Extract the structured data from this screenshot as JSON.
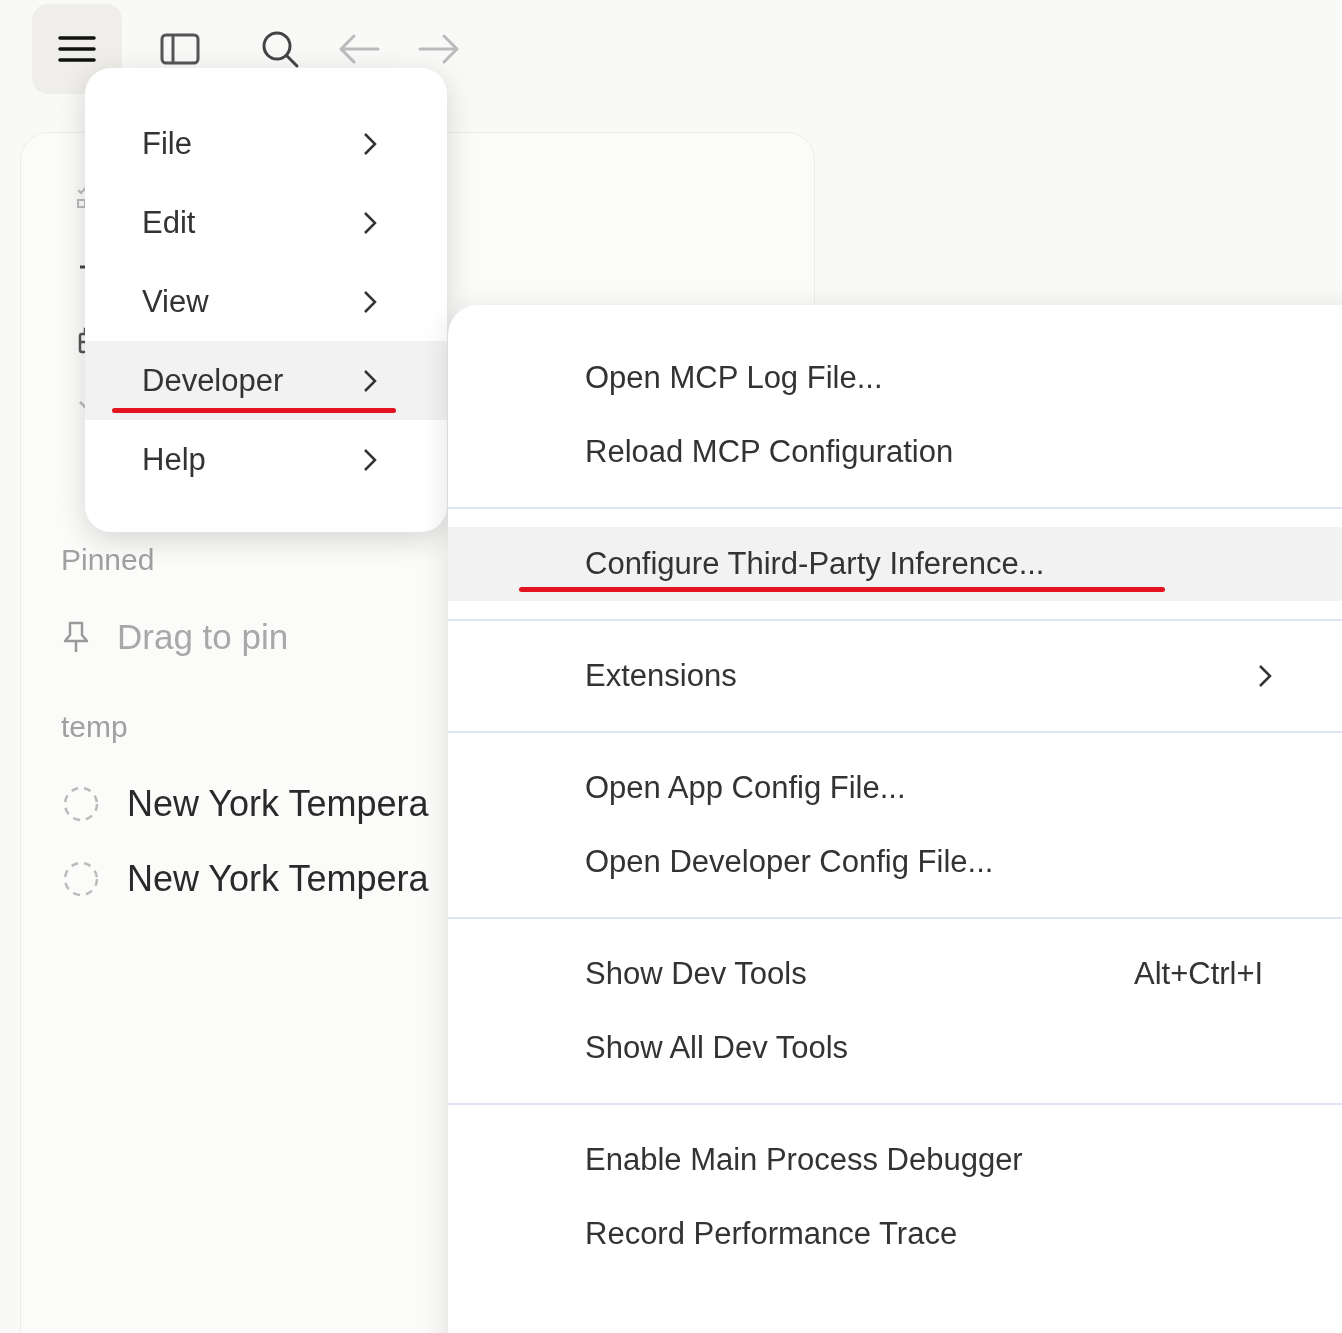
{
  "toolbar": {
    "menu_open": true,
    "back_disabled": true,
    "forward_disabled": true
  },
  "sidebar": {
    "sections": [
      {
        "title": "Pinned",
        "items": [
          {
            "kind": "placeholder",
            "label": "Drag to pin"
          }
        ]
      },
      {
        "title": "temp",
        "items": [
          {
            "kind": "chat",
            "label": "New York Tempera"
          },
          {
            "kind": "chat",
            "label": "New York Tempera"
          }
        ]
      }
    ]
  },
  "menu": {
    "items": [
      {
        "label": "File",
        "selected": false,
        "underlined": false
      },
      {
        "label": "Edit",
        "selected": false,
        "underlined": false
      },
      {
        "label": "View",
        "selected": false,
        "underlined": false
      },
      {
        "label": "Developer",
        "selected": true,
        "underlined": true
      },
      {
        "label": "Help",
        "selected": false,
        "underlined": false
      }
    ]
  },
  "submenu": {
    "groups": [
      [
        {
          "kind": "action",
          "label": "Open MCP Log File...",
          "selected": false,
          "underlined": false
        },
        {
          "kind": "action",
          "label": "Reload MCP Configuration",
          "selected": false,
          "underlined": false
        }
      ],
      [
        {
          "kind": "action",
          "label": "Configure Third-Party Inference...",
          "selected": true,
          "underlined": true
        }
      ],
      [
        {
          "kind": "submenu",
          "label": "Extensions",
          "selected": false,
          "underlined": false
        }
      ],
      [
        {
          "kind": "action",
          "label": "Open App Config File...",
          "selected": false,
          "underlined": false
        },
        {
          "kind": "action",
          "label": "Open Developer Config File...",
          "selected": false,
          "underlined": false
        }
      ],
      [
        {
          "kind": "action",
          "label": "Show Dev Tools",
          "shortcut": "Alt+Ctrl+I",
          "selected": false,
          "underlined": false
        },
        {
          "kind": "action",
          "label": "Show All Dev Tools",
          "selected": false,
          "underlined": false
        }
      ],
      [
        {
          "kind": "action",
          "label": "Enable Main Process Debugger",
          "selected": false,
          "underlined": false
        },
        {
          "kind": "action",
          "label": "Record Performance Trace",
          "selected": false,
          "underlined": false
        }
      ]
    ]
  }
}
